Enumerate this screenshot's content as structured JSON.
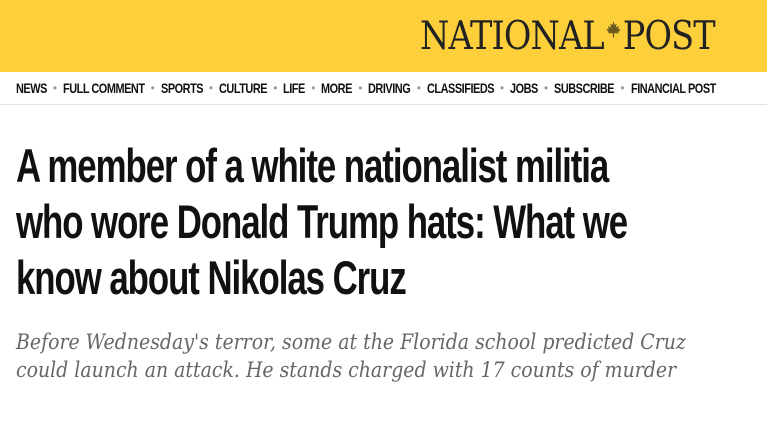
{
  "masthead": {
    "logo_left": "NATIONAL",
    "logo_right": "POST",
    "background": "#fdd03b",
    "logo_icon": "maple-leaf-icon"
  },
  "nav": {
    "items": [
      {
        "label": "NEWS"
      },
      {
        "label": "FULL COMMENT"
      },
      {
        "label": "SPORTS"
      },
      {
        "label": "CULTURE"
      },
      {
        "label": "LIFE"
      },
      {
        "label": "MORE"
      },
      {
        "label": "DRIVING"
      },
      {
        "label": "CLASSIFIEDS"
      },
      {
        "label": "JOBS"
      },
      {
        "label": "SUBSCRIBE"
      },
      {
        "label": "FINANCIAL POST"
      }
    ],
    "separator": "•"
  },
  "article": {
    "headline": "A member of a white nationalist militia who wore Donald Trump hats: What we know about Nikolas Cruz",
    "deck": "Before Wednesday's terror, some at the Florida school predicted Cruz could launch an attack. He stands charged with 17 counts of murder"
  }
}
